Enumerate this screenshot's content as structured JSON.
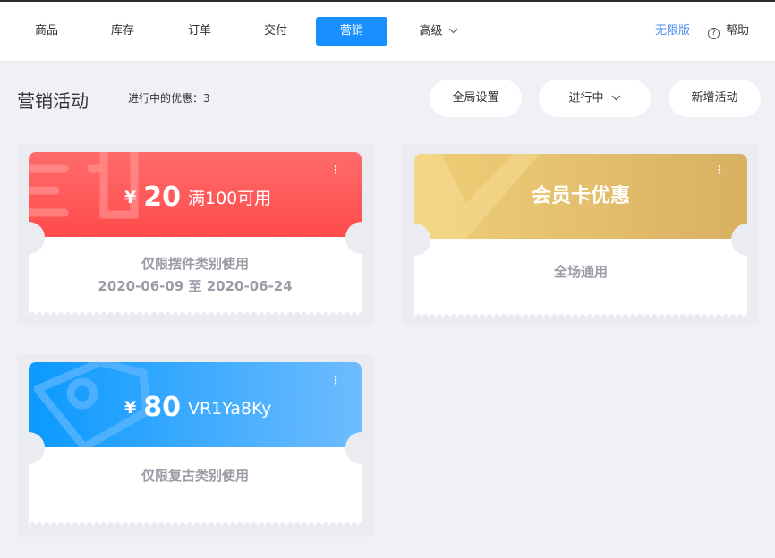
{
  "nav": {
    "items": [
      {
        "label": "商品"
      },
      {
        "label": "库存"
      },
      {
        "label": "订单"
      },
      {
        "label": "交付"
      },
      {
        "label": "营销"
      },
      {
        "label": "高级"
      }
    ],
    "upgrade_label": "无限版",
    "help_label": "帮助"
  },
  "header": {
    "title": "营销活动",
    "active_count": "进行中的优惠：3",
    "global_settings_label": "全局设置",
    "status_filter_label": "进行中",
    "add_label": "新增活动"
  },
  "coupons": [
    {
      "currency": "¥",
      "amount": "20",
      "condition": "满100可用",
      "scope": "仅限摆件类别使用",
      "date_range": "2020-06-09 至 2020-06-24",
      "color_start": "#ff6a6a",
      "color_end": "#ff4a4a"
    },
    {
      "title": "会员卡优惠",
      "scope": "全场通用",
      "color_start": "#f2d27a",
      "color_end": "#d9b15e"
    },
    {
      "currency": "¥",
      "amount": "80",
      "code": "VR1Ya8Ky",
      "scope": "仅限复古类别使用",
      "color_start": "#0f9bff",
      "color_end": "#6fbaff"
    }
  ],
  "colors": {
    "accent": "#1890ff",
    "upgrade_link": "#4a8ef0",
    "background": "#f0f1f6"
  },
  "icons": {
    "nav_dropdown": "chevron-down-icon",
    "help": "help-circle-icon",
    "card_menu": "more-vertical-icon"
  }
}
